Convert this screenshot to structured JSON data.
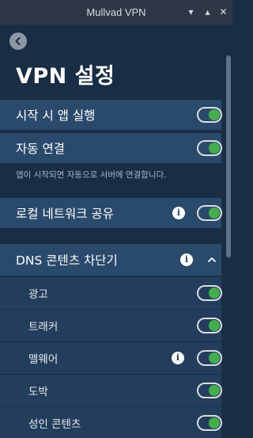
{
  "window": {
    "title": "Mullvad VPN"
  },
  "page": {
    "title": "VPN 설정"
  },
  "settings": {
    "launch_at_startup": {
      "label": "시작 시 앱 실행",
      "enabled": true
    },
    "auto_connect": {
      "label": "자동 연결",
      "enabled": true,
      "description": "앱이 시작되면 자동으로 서버에 연결합니다."
    },
    "lan_sharing": {
      "label": "로컬 네트워크 공유",
      "enabled": true
    },
    "dns_blocker": {
      "label": "DNS 콘텐츠 차단기",
      "expanded": true,
      "items": [
        {
          "label": "광고",
          "enabled": true,
          "info": false
        },
        {
          "label": "트래커",
          "enabled": true,
          "info": false
        },
        {
          "label": "맬웨어",
          "enabled": true,
          "info": true
        },
        {
          "label": "도박",
          "enabled": true,
          "info": false
        },
        {
          "label": "성인 콘텐츠",
          "enabled": true,
          "info": false
        }
      ]
    }
  },
  "colors": {
    "background": "#192e45",
    "row": "#2a4a6c",
    "sub_row": "#233e5c",
    "toggle_on": "#44ad4d"
  },
  "icons": {
    "back": "chevron-left-icon",
    "info": "info-icon",
    "collapse": "chevron-up-icon"
  }
}
